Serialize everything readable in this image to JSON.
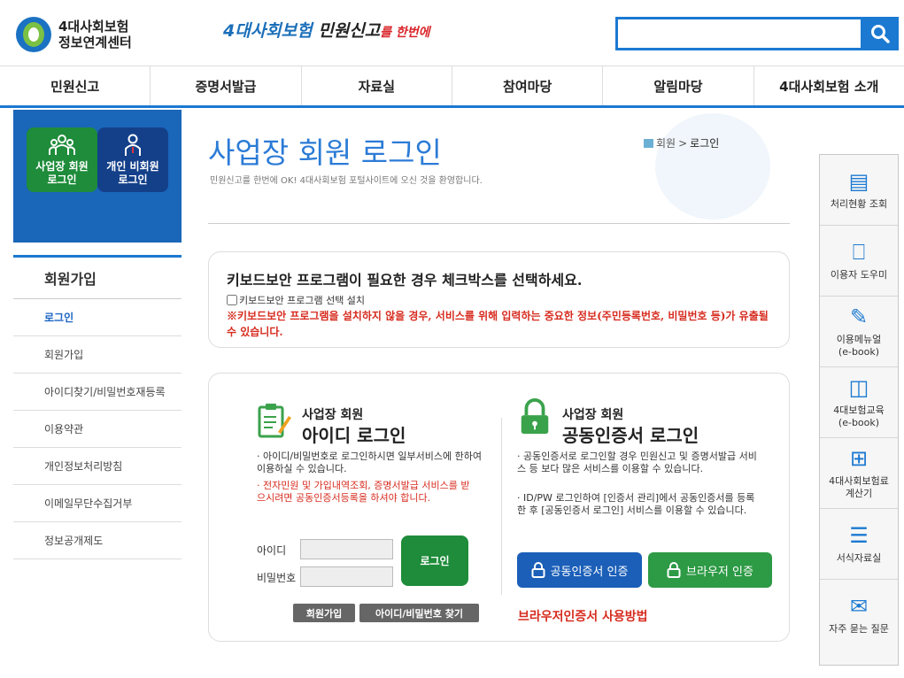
{
  "header": {
    "logo_line1": "4대사회보험",
    "logo_line2": "정보연계센터",
    "slogan_part1": "4대사회보험",
    "slogan_part2": " 민원신고",
    "slogan_part3": "를 한번에",
    "search_icon": "search-icon"
  },
  "gnb": [
    "민원신고",
    "증명서발급",
    "자료실",
    "참여마당",
    "알림마당",
    "4대사회보험 소개"
  ],
  "left_tabs": {
    "business": {
      "line1": "사업장 회원",
      "line2": "로그인",
      "icon": "group-icon"
    },
    "personal": {
      "line1": "개인 비회원",
      "line2": "로그인",
      "icon": "person-icon"
    }
  },
  "lnb": {
    "heading": "회원가입",
    "items": [
      "로그인",
      "회원가입",
      "아이디찾기/비밀번호재등록",
      "이용약관",
      "개인정보처리방침",
      "이메일무단수집거부",
      "정보공개제도"
    ]
  },
  "page": {
    "title": "사업장 회원 로그인",
    "desc": "민원신고를 한번에 OK! 4대사회보험 포털사이트에 오신 것을 환영합니다.",
    "crumb_home": "회원",
    "crumb_sep": ">",
    "crumb_current": "로그인"
  },
  "keyboard": {
    "title": "키보드보안 프로그램이 필요한 경우 체크박스를 선택하세요.",
    "checkbox_label": "키보드보안 프로그램 선택 설치",
    "warning": "※키보드보안 프로그램을 설치하지 않을 경우, 서비스를 위해 입력하는 중요한 정보(주민등록번호, 비밀번호 등)가 유출될 수 있습니다."
  },
  "id_login": {
    "sub": "사업장 회원",
    "title": "아이디 로그인",
    "bullet1": "아이디/비밀번호로 로그인하시면 일부서비스에 한하여 이용하실 수 있습니다.",
    "bullet2": "전자민원 및 가입내역조회, 증명서발급 서비스를 받으시려면 공동인증서등록을 하셔야 합니다.",
    "id_label": "아이디",
    "pw_label": "비밀번호",
    "login_button": "로그인",
    "join_button": "회원가입",
    "find_button": "아이디/비밀번호 찾기"
  },
  "cert_login": {
    "sub": "사업장 회원",
    "title": "공동인증서 로그인",
    "bullet1": "공동인증서로 로그인할 경우 민원신고 및 증명서발급 서비스 등 보다 많은 서비스를 이용할 수 있습니다.",
    "bullet2": "ID/PW 로그인하여 [인증서 관리]에서 공동인증서를 등록한 후 [공동인증서 로그인] 서비스를 이용할 수 있습니다.",
    "cert_button": "공동인증서 인증",
    "browser_button": "브라우저 인증",
    "browser_howto": "브라우저인증서 사용방법"
  },
  "quick": [
    {
      "label": "처리현황 조회",
      "icon": "document-search-icon"
    },
    {
      "label": "이용자 도우미",
      "icon": "help-monitor-icon"
    },
    {
      "label": "이용메뉴얼\n(e-book)",
      "icon": "manual-icon"
    },
    {
      "label": "4대보험교육\n(e-book)",
      "icon": "book-icon"
    },
    {
      "label": "4대사회보험료\n계산기",
      "icon": "calculator-icon"
    },
    {
      "label": "서식자료실",
      "icon": "forms-icon"
    },
    {
      "label": "자주 묻는 질문",
      "icon": "faq-icon"
    }
  ]
}
